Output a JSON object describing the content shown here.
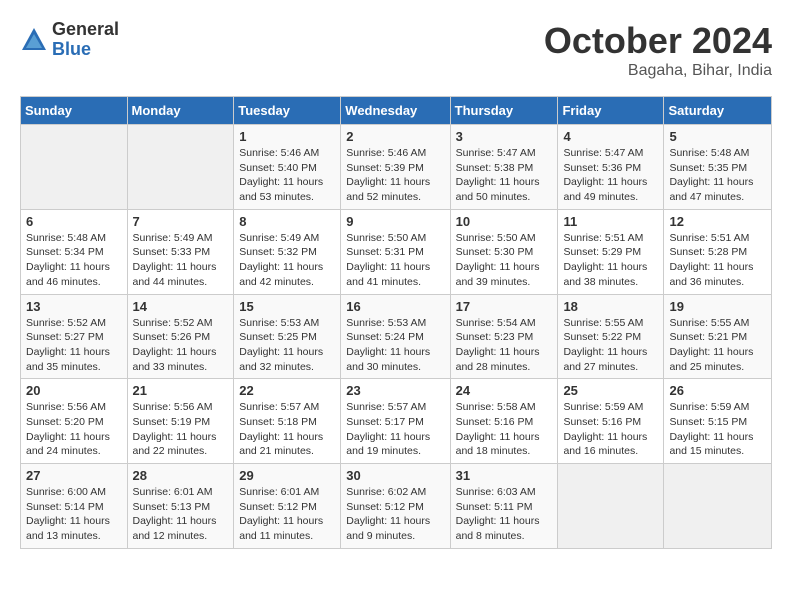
{
  "logo": {
    "general": "General",
    "blue": "Blue"
  },
  "title": "October 2024",
  "location": "Bagaha, Bihar, India",
  "days_of_week": [
    "Sunday",
    "Monday",
    "Tuesday",
    "Wednesday",
    "Thursday",
    "Friday",
    "Saturday"
  ],
  "weeks": [
    [
      {
        "day": "",
        "sunrise": "",
        "sunset": "",
        "daylight": ""
      },
      {
        "day": "",
        "sunrise": "",
        "sunset": "",
        "daylight": ""
      },
      {
        "day": "1",
        "sunrise": "Sunrise: 5:46 AM",
        "sunset": "Sunset: 5:40 PM",
        "daylight": "Daylight: 11 hours and 53 minutes."
      },
      {
        "day": "2",
        "sunrise": "Sunrise: 5:46 AM",
        "sunset": "Sunset: 5:39 PM",
        "daylight": "Daylight: 11 hours and 52 minutes."
      },
      {
        "day": "3",
        "sunrise": "Sunrise: 5:47 AM",
        "sunset": "Sunset: 5:38 PM",
        "daylight": "Daylight: 11 hours and 50 minutes."
      },
      {
        "day": "4",
        "sunrise": "Sunrise: 5:47 AM",
        "sunset": "Sunset: 5:36 PM",
        "daylight": "Daylight: 11 hours and 49 minutes."
      },
      {
        "day": "5",
        "sunrise": "Sunrise: 5:48 AM",
        "sunset": "Sunset: 5:35 PM",
        "daylight": "Daylight: 11 hours and 47 minutes."
      }
    ],
    [
      {
        "day": "6",
        "sunrise": "Sunrise: 5:48 AM",
        "sunset": "Sunset: 5:34 PM",
        "daylight": "Daylight: 11 hours and 46 minutes."
      },
      {
        "day": "7",
        "sunrise": "Sunrise: 5:49 AM",
        "sunset": "Sunset: 5:33 PM",
        "daylight": "Daylight: 11 hours and 44 minutes."
      },
      {
        "day": "8",
        "sunrise": "Sunrise: 5:49 AM",
        "sunset": "Sunset: 5:32 PM",
        "daylight": "Daylight: 11 hours and 42 minutes."
      },
      {
        "day": "9",
        "sunrise": "Sunrise: 5:50 AM",
        "sunset": "Sunset: 5:31 PM",
        "daylight": "Daylight: 11 hours and 41 minutes."
      },
      {
        "day": "10",
        "sunrise": "Sunrise: 5:50 AM",
        "sunset": "Sunset: 5:30 PM",
        "daylight": "Daylight: 11 hours and 39 minutes."
      },
      {
        "day": "11",
        "sunrise": "Sunrise: 5:51 AM",
        "sunset": "Sunset: 5:29 PM",
        "daylight": "Daylight: 11 hours and 38 minutes."
      },
      {
        "day": "12",
        "sunrise": "Sunrise: 5:51 AM",
        "sunset": "Sunset: 5:28 PM",
        "daylight": "Daylight: 11 hours and 36 minutes."
      }
    ],
    [
      {
        "day": "13",
        "sunrise": "Sunrise: 5:52 AM",
        "sunset": "Sunset: 5:27 PM",
        "daylight": "Daylight: 11 hours and 35 minutes."
      },
      {
        "day": "14",
        "sunrise": "Sunrise: 5:52 AM",
        "sunset": "Sunset: 5:26 PM",
        "daylight": "Daylight: 11 hours and 33 minutes."
      },
      {
        "day": "15",
        "sunrise": "Sunrise: 5:53 AM",
        "sunset": "Sunset: 5:25 PM",
        "daylight": "Daylight: 11 hours and 32 minutes."
      },
      {
        "day": "16",
        "sunrise": "Sunrise: 5:53 AM",
        "sunset": "Sunset: 5:24 PM",
        "daylight": "Daylight: 11 hours and 30 minutes."
      },
      {
        "day": "17",
        "sunrise": "Sunrise: 5:54 AM",
        "sunset": "Sunset: 5:23 PM",
        "daylight": "Daylight: 11 hours and 28 minutes."
      },
      {
        "day": "18",
        "sunrise": "Sunrise: 5:55 AM",
        "sunset": "Sunset: 5:22 PM",
        "daylight": "Daylight: 11 hours and 27 minutes."
      },
      {
        "day": "19",
        "sunrise": "Sunrise: 5:55 AM",
        "sunset": "Sunset: 5:21 PM",
        "daylight": "Daylight: 11 hours and 25 minutes."
      }
    ],
    [
      {
        "day": "20",
        "sunrise": "Sunrise: 5:56 AM",
        "sunset": "Sunset: 5:20 PM",
        "daylight": "Daylight: 11 hours and 24 minutes."
      },
      {
        "day": "21",
        "sunrise": "Sunrise: 5:56 AM",
        "sunset": "Sunset: 5:19 PM",
        "daylight": "Daylight: 11 hours and 22 minutes."
      },
      {
        "day": "22",
        "sunrise": "Sunrise: 5:57 AM",
        "sunset": "Sunset: 5:18 PM",
        "daylight": "Daylight: 11 hours and 21 minutes."
      },
      {
        "day": "23",
        "sunrise": "Sunrise: 5:57 AM",
        "sunset": "Sunset: 5:17 PM",
        "daylight": "Daylight: 11 hours and 19 minutes."
      },
      {
        "day": "24",
        "sunrise": "Sunrise: 5:58 AM",
        "sunset": "Sunset: 5:16 PM",
        "daylight": "Daylight: 11 hours and 18 minutes."
      },
      {
        "day": "25",
        "sunrise": "Sunrise: 5:59 AM",
        "sunset": "Sunset: 5:16 PM",
        "daylight": "Daylight: 11 hours and 16 minutes."
      },
      {
        "day": "26",
        "sunrise": "Sunrise: 5:59 AM",
        "sunset": "Sunset: 5:15 PM",
        "daylight": "Daylight: 11 hours and 15 minutes."
      }
    ],
    [
      {
        "day": "27",
        "sunrise": "Sunrise: 6:00 AM",
        "sunset": "Sunset: 5:14 PM",
        "daylight": "Daylight: 11 hours and 13 minutes."
      },
      {
        "day": "28",
        "sunrise": "Sunrise: 6:01 AM",
        "sunset": "Sunset: 5:13 PM",
        "daylight": "Daylight: 11 hours and 12 minutes."
      },
      {
        "day": "29",
        "sunrise": "Sunrise: 6:01 AM",
        "sunset": "Sunset: 5:12 PM",
        "daylight": "Daylight: 11 hours and 11 minutes."
      },
      {
        "day": "30",
        "sunrise": "Sunrise: 6:02 AM",
        "sunset": "Sunset: 5:12 PM",
        "daylight": "Daylight: 11 hours and 9 minutes."
      },
      {
        "day": "31",
        "sunrise": "Sunrise: 6:03 AM",
        "sunset": "Sunset: 5:11 PM",
        "daylight": "Daylight: 11 hours and 8 minutes."
      },
      {
        "day": "",
        "sunrise": "",
        "sunset": "",
        "daylight": ""
      },
      {
        "day": "",
        "sunrise": "",
        "sunset": "",
        "daylight": ""
      }
    ]
  ]
}
